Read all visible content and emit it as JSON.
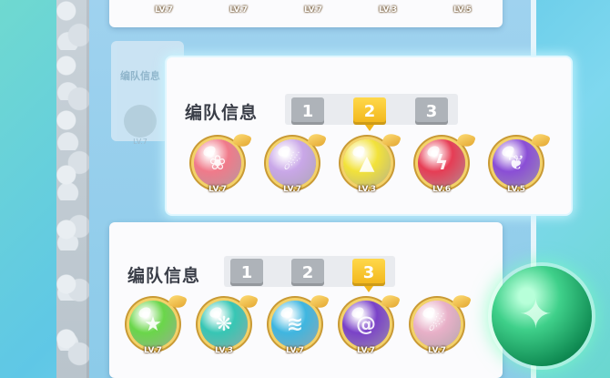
{
  "top_card": {
    "levels": [
      "LV.7",
      "LV.7",
      "LV.7",
      "LV.3",
      "LV.5"
    ]
  },
  "faded_card": {
    "title": "编队信息",
    "levels": [
      "LV.7"
    ]
  },
  "team1": {
    "title": "编队信息",
    "tabs": [
      "1",
      "2",
      "3"
    ],
    "active_tab": 2,
    "orbs": [
      {
        "icon": "flower-icon",
        "color": "#f07a8a",
        "glyph": "❀",
        "level": "LV.7"
      },
      {
        "icon": "hands-icon",
        "color": "#c9a7e8",
        "glyph": "☄",
        "level": "LV.7"
      },
      {
        "icon": "arrow-up-icon",
        "color": "#f2e23a",
        "glyph": "▲",
        "level": "LV.3"
      },
      {
        "icon": "lightning-icon",
        "color": "#e63d55",
        "glyph": "ϟ",
        "level": "LV.6"
      },
      {
        "icon": "butterfly-icon",
        "color": "#8a4ed6",
        "glyph": "❦",
        "level": "LV.5"
      }
    ]
  },
  "team2": {
    "title": "编队信息",
    "tabs": [
      "1",
      "2",
      "3"
    ],
    "active_tab": 3,
    "orbs": [
      {
        "icon": "star-icon",
        "color": "#6ad64a",
        "glyph": "★",
        "level": "LV.7"
      },
      {
        "icon": "wave-hands-icon",
        "color": "#37c6b4",
        "glyph": "❋",
        "level": "LV.3"
      },
      {
        "icon": "wave-icon",
        "color": "#3fb6e0",
        "glyph": "≋",
        "level": "LV.7"
      },
      {
        "icon": "spiral-icon",
        "color": "#7a42c8",
        "glyph": "@",
        "level": "LV.7"
      },
      {
        "icon": "hands-icon",
        "color": "#e8b0c8",
        "glyph": "☄",
        "level": "LV.7"
      }
    ]
  },
  "big_orb": {
    "icon": "star-orb-icon",
    "color": "#2ecf7e"
  }
}
